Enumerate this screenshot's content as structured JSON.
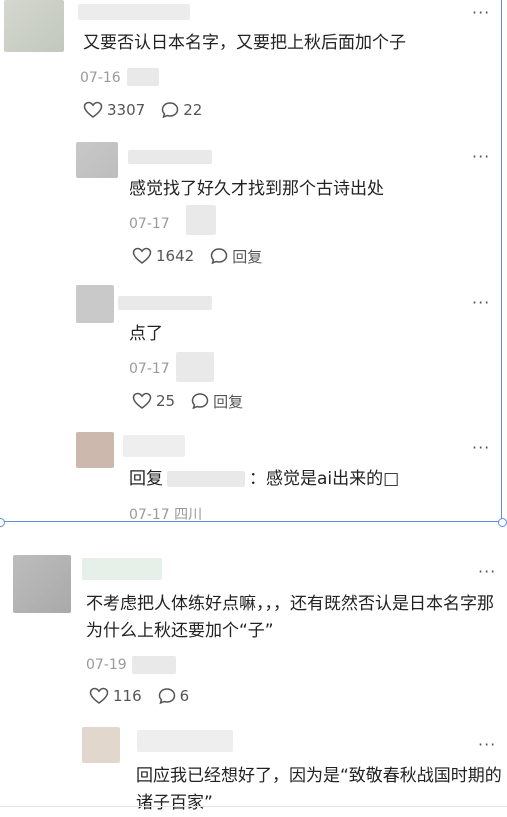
{
  "comments": [
    {
      "text": "又要否认日本名字，又要把上秋后面加个子",
      "date": "07-16",
      "likes": "3307",
      "replies": "22"
    },
    {
      "text": "感觉找了好久才找到那个古诗出处",
      "date": "07-17",
      "likes": "1642",
      "reply_label": "回复"
    },
    {
      "text": "点了",
      "date": "07-17",
      "likes": "25",
      "reply_label": "回复"
    },
    {
      "text_prefix": "回复",
      "text_suffix": "：感觉是ai出来的□",
      "date": "07-17",
      "location": "四川"
    },
    {
      "text": "不考虑把人体练好点嘛，，，还有既然否认是日本名字那为什么上秋还要加个“子”",
      "date": "07-19",
      "likes": "116",
      "replies": "6"
    },
    {
      "text": "回应我已经想好了，因为是“致敬春秋战国时期的诸子百家”"
    }
  ],
  "icons": {
    "like": "heart-outline-icon",
    "comment": "speech-bubble-icon",
    "more": "more-dots-icon"
  },
  "colors": {
    "selection": "#5a8fe0",
    "meta_text": "#9a9a9a",
    "body_text": "#222222"
  }
}
